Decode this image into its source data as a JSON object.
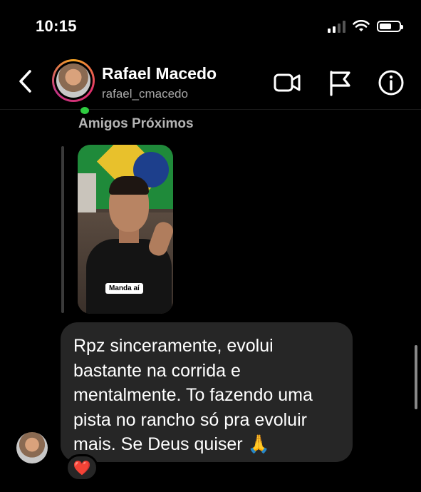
{
  "status_bar": {
    "time": "10:15"
  },
  "header": {
    "contact_name": "Rafael Macedo",
    "contact_handle": "rafael_cmacedo",
    "icons": [
      "back-icon",
      "video-call-icon",
      "report-flag-icon",
      "info-icon"
    ]
  },
  "story_reply": {
    "audience_label": "Amigos Próximos",
    "story_caption": "Manda aí"
  },
  "messages": [
    {
      "text": "Rpz sinceramente, evolui\nbastante na corrida e\nmentalmente. To fazendo uma\npista no rancho só pra evoluir\nmais. Se Deus quiser 🙏",
      "reaction": "❤️"
    }
  ],
  "colors": {
    "background": "#000000",
    "bubble": "#262626",
    "secondary_text": "#a8a8a8"
  }
}
